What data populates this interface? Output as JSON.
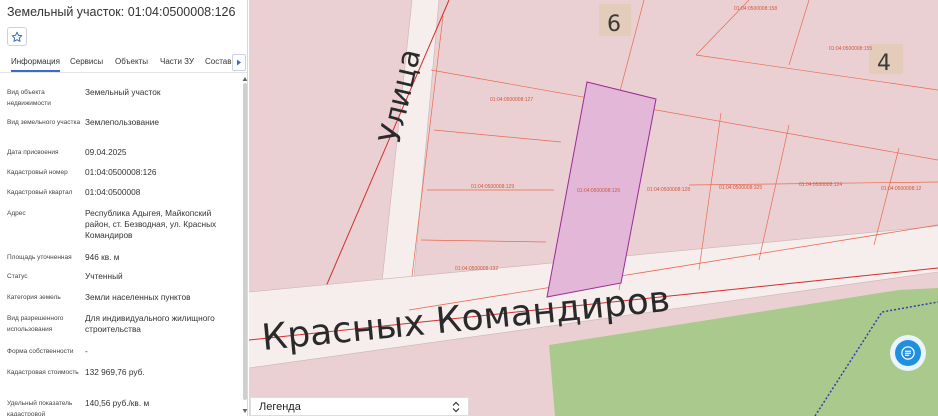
{
  "panel": {
    "title": "Земельный участок: 01:04:0500008:126",
    "tabs": [
      {
        "label": "Информация",
        "active": true
      },
      {
        "label": "Сервисы"
      },
      {
        "label": "Объекты"
      },
      {
        "label": "Части ЗУ"
      },
      {
        "label": "Состав"
      }
    ],
    "rows": [
      {
        "label": "Вид объекта недвижимости",
        "value": "Земельный участок"
      },
      {
        "label": "Вид земельного участка",
        "value": "Землепользование"
      },
      {
        "label": "Дата присвоения",
        "value": "09.04.2025"
      },
      {
        "label": "Кадастровый номер",
        "value": "01:04:0500008:126"
      },
      {
        "label": "Кадастровый квартал",
        "value": "01:04:0500008"
      },
      {
        "label": "Адрес",
        "value": "Республика Адыгея, Майкопский район, ст. Безводная, ул. Красных Командиров"
      },
      {
        "label": "Площадь уточненная",
        "value": "946 кв. м"
      },
      {
        "label": "Статус",
        "value": "Учтенный"
      },
      {
        "label": "Категория земель",
        "value": "Земли населенных пунктов"
      },
      {
        "label": "Вид разрешенного использования",
        "value": "Для индивидуального жилищного строительства"
      },
      {
        "label": "Форма собственности",
        "value": "-"
      },
      {
        "label": "Кадастровая стоимость",
        "value": "132 969,76 руб."
      },
      {
        "label": "Удельный показатель кадастровой",
        "value": "140,56 руб./кв. м"
      }
    ]
  },
  "map": {
    "street_vertical": "Улица",
    "street_horizontal": "Красных Командиров",
    "block_numbers": [
      "6",
      "4"
    ],
    "parcel_labels": [
      "01:04:0500008:158",
      "01:04:0500008:155",
      "01:04:0500008:127",
      "01:04:0500008:129",
      "01:04:0500008:126",
      "01:04:0500008:128",
      "01:04:0500008:325",
      "01:04:0500008:124",
      "01:04:0500008:12",
      "01:04:0500008:132"
    ],
    "selected_parcel_color": "#e2b7d8",
    "boundary_color": "#e86a52",
    "legend_label": "Легенда"
  }
}
